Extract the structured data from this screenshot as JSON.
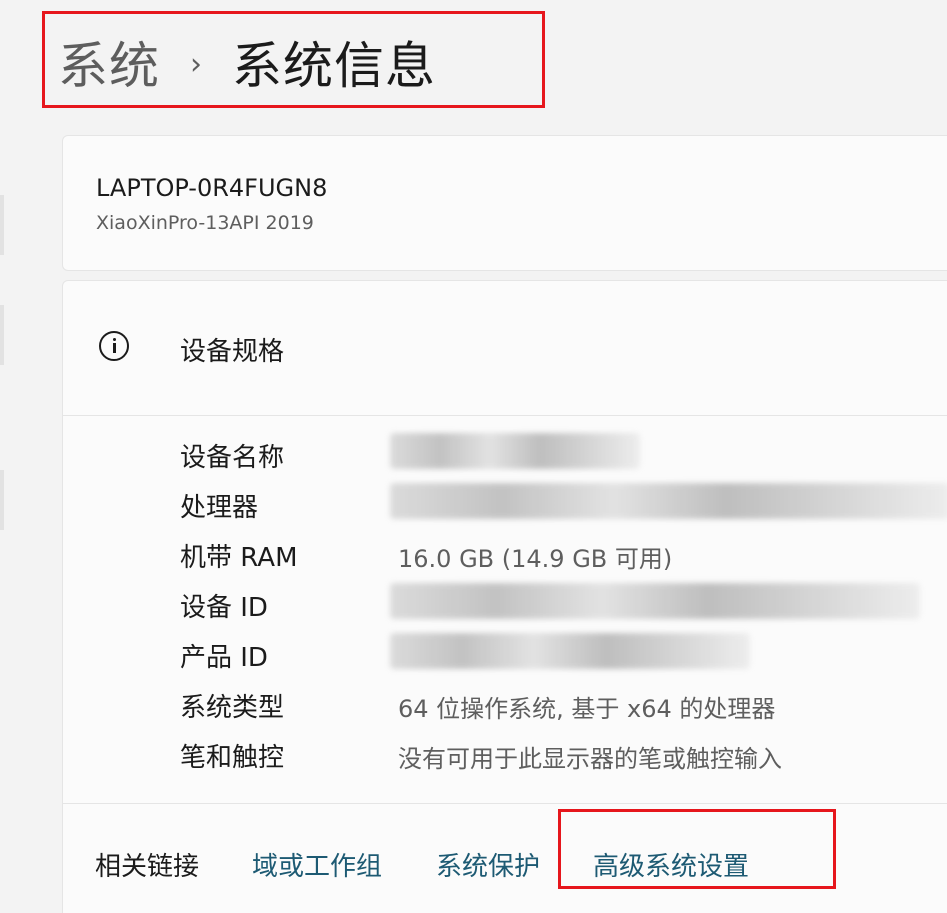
{
  "breadcrumb": {
    "parent": "系统",
    "separator": "›",
    "current": "系统信息"
  },
  "device": {
    "name": "LAPTOP-0R4FUGN8",
    "model": "XiaoXinPro-13API 2019"
  },
  "specs": {
    "title": "设备规格",
    "icon": "info-icon",
    "rows": [
      {
        "label": "设备名称",
        "value": "",
        "redacted": true
      },
      {
        "label": "处理器",
        "value": "",
        "redacted": true
      },
      {
        "label": "机带 RAM",
        "value": "16.0 GB (14.9 GB 可用)",
        "redacted": false
      },
      {
        "label": "设备 ID",
        "value": "",
        "redacted": true
      },
      {
        "label": "产品 ID",
        "value": "",
        "redacted": true
      },
      {
        "label": "系统类型",
        "value": "64 位操作系统, 基于 x64 的处理器",
        "redacted": false
      },
      {
        "label": "笔和触控",
        "value": "没有可用于此显示器的笔或触控输入",
        "redacted": false
      }
    ]
  },
  "related_links": {
    "label": "相关链接",
    "links": [
      "域或工作组",
      "系统保护",
      "高级系统设置"
    ]
  },
  "colors": {
    "highlight_box": "#e6161c",
    "link": "#1d5a73"
  }
}
